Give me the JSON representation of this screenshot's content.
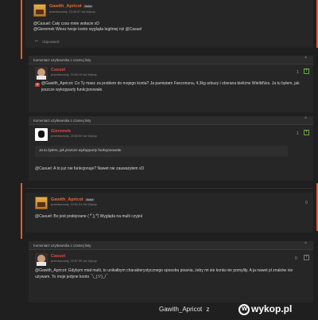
{
  "comments": [
    {
      "author": "Gawith_Apricot",
      "badge": "Autor",
      "meta": "przedwczoraj, 23:49:37 via Wykop",
      "lines": [
        "@Casuel: Cały czas mnie wołacie xD",
        "@Gieremek Wiesz twoje konto wygląda legitniej niż @Casuel"
      ],
      "reply": "Odpowiedz"
    }
  ],
  "headers": {
    "h1": "Komentarz użytkownika z czarnej listy",
    "h2": "Komentarz użytkownika z czarnej listy",
    "h3": "Komentarz użytkownika z czarnej listy"
  },
  "casuel1": {
    "author": "Casuel",
    "meta": "przedwczoraj, 23:50:19 via Wykop",
    "text": "@Gawith_Apricot: Co Ty masz za problem do mojego konta? Ja pamiętam Fanzonuna, 4,3kg arbuzy i obsrana bieliżne WielkiNos. Ja tu byłem, jak jeszcze wykopparty funkcjonowało",
    "vote": "1"
  },
  "gieremek": {
    "author": "Gieremek",
    "meta": "przedwczoraj, 23:50:53 via Wykop",
    "quote": "Ja tu byłem, jak jeszcze wykopparty funkcjonowało",
    "text": "@Casuel: A to już nie funkcjonuje? Nawet nie zauważyłem xD",
    "vote": "1"
  },
  "gawith2": {
    "author": "Gawith_Apricot",
    "badge": "Autor",
    "meta": "przedwczoraj, 23:51:31 via Wykop",
    "text": "@Casuel: Bo jest podejrzane ( ͡° ͜ʖ ͡°) Wygląda na multi czyjeś",
    "vote": "0"
  },
  "casuel2": {
    "author": "Casuel",
    "meta": "przedwczoraj, 23:57:39 via Wykop",
    "text": "@Gawith_Apricot: Gdybym miał multi, to unikałbym charakterystycznego sposobu pisania, żeby mi sie konta nie pomyliły. A ja nawet pl znaków nie używam. To moje jedyne konto ¯\\_(ツ)_/¯",
    "vote": "0"
  },
  "footer": {
    "username": "Gawith_Apricot",
    "separator": "z",
    "site": "wykop.pl"
  },
  "colors": {
    "accent": "#f25a21",
    "bg": "#1f1f1f",
    "card": "#262626",
    "green": "#7cc24a"
  }
}
